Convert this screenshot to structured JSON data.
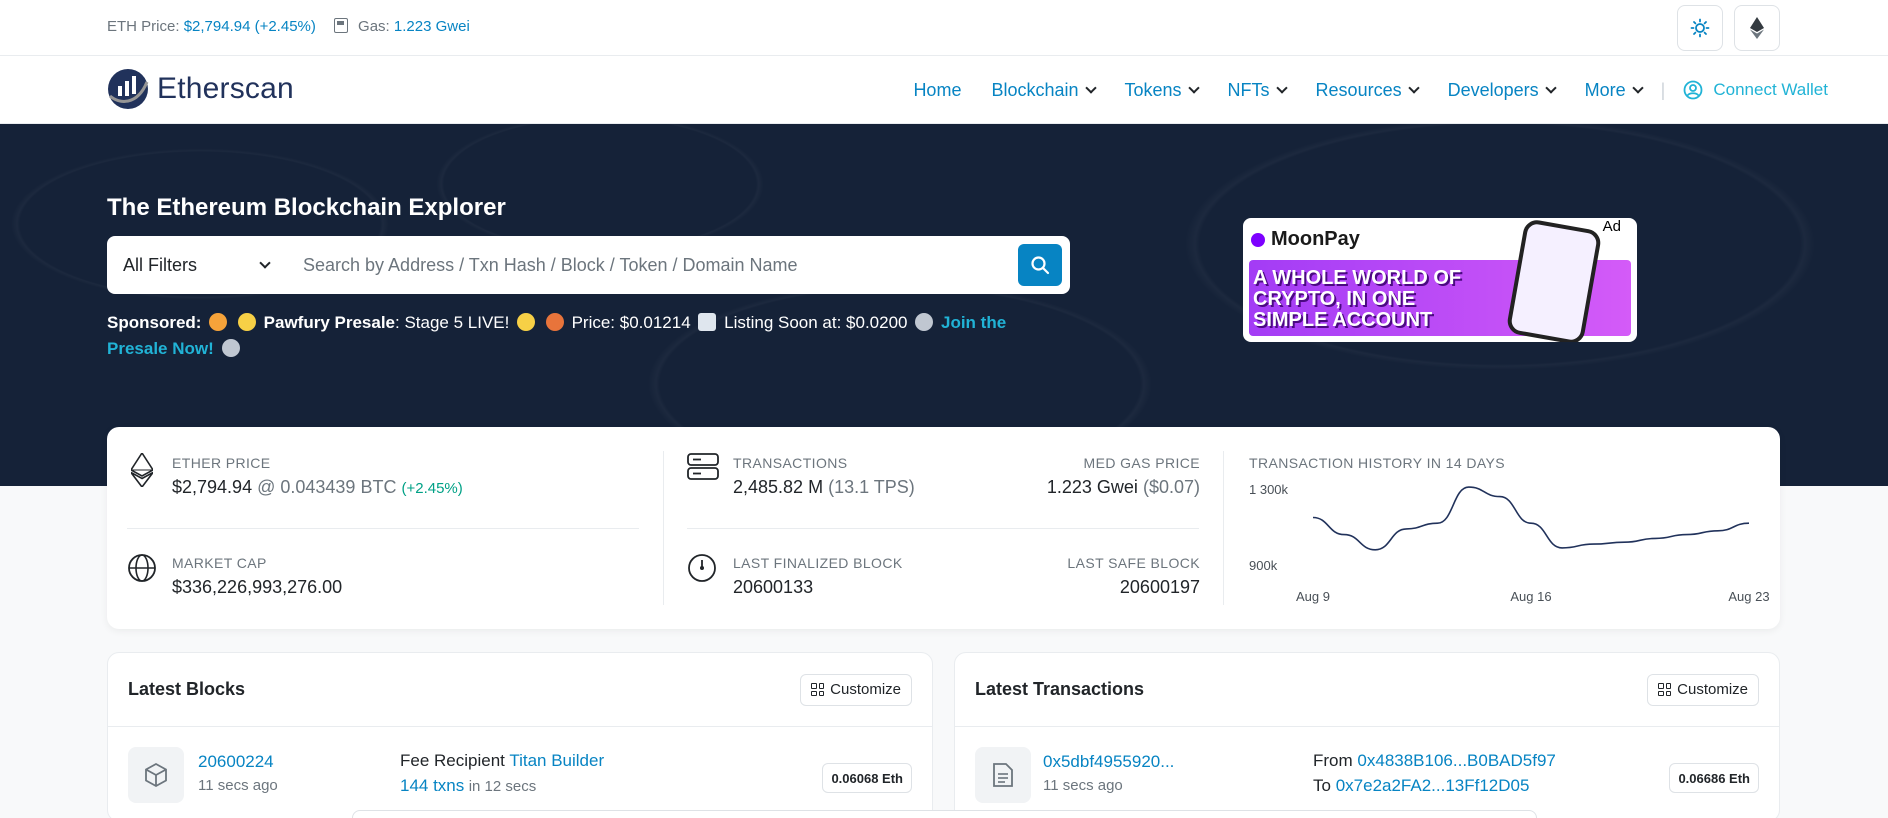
{
  "topbar": {
    "eth_price_label": "ETH Price:",
    "eth_price_value": "$2,794.94 (+2.45%)",
    "gas_label": "Gas:",
    "gas_value": "1.223 Gwei"
  },
  "nav": {
    "brand": "Etherscan",
    "items": [
      {
        "label": "Home"
      },
      {
        "label": "Blockchain"
      },
      {
        "label": "Tokens"
      },
      {
        "label": "NFTs"
      },
      {
        "label": "Resources"
      },
      {
        "label": "Developers"
      },
      {
        "label": "More"
      }
    ],
    "separator": "|",
    "connect_wallet": "Connect Wallet"
  },
  "hero": {
    "title": "The Ethereum Blockchain Explorer",
    "filter_label": "All Filters",
    "search_placeholder": "Search by Address / Txn Hash / Block / Token / Domain Name",
    "sponsored_label": "Sponsored:",
    "sponsored_name": "Pawfury Presale",
    "sponsored_text_1": ": Stage 5 LIVE!",
    "sponsored_text_2": "Price: $0.01214",
    "sponsored_text_3": "Listing Soon at: $0.0200",
    "sponsored_link": "Join the Presale Now!"
  },
  "ad": {
    "tag": "Ad",
    "brand": "MoonPay",
    "slogan": "A whole world of crypto, in one simple account"
  },
  "stats": {
    "ether_price_label": "ETHER PRICE",
    "ether_price_value": "$2,794.94",
    "ether_price_btc": "@ 0.043439 BTC",
    "ether_price_change": "(+2.45%)",
    "market_cap_label": "MARKET CAP",
    "market_cap_value": "$336,226,993,276.00",
    "transactions_label": "TRANSACTIONS",
    "transactions_value": "2,485.82 M",
    "transactions_tps": "(13.1 TPS)",
    "med_gas_label": "MED GAS PRICE",
    "med_gas_value": "1.223 Gwei",
    "med_gas_usd": "($0.07)",
    "last_finalized_label": "LAST FINALIZED BLOCK",
    "last_finalized_value": "20600133",
    "last_safe_label": "LAST SAFE BLOCK",
    "last_safe_value": "20600197"
  },
  "chart_data": {
    "type": "line",
    "title": "TRANSACTION HISTORY IN 14 DAYS",
    "x": [
      "Aug 9",
      "Aug 10",
      "Aug 11",
      "Aug 12",
      "Aug 13",
      "Aug 14",
      "Aug 15",
      "Aug 16",
      "Aug 17",
      "Aug 18",
      "Aug 19",
      "Aug 20",
      "Aug 21",
      "Aug 22",
      "Aug 23"
    ],
    "values": [
      1150000,
      1060000,
      980000,
      1090000,
      1120000,
      1310000,
      1260000,
      1120000,
      990000,
      1010000,
      1020000,
      1040000,
      1060000,
      1080000,
      1120000
    ],
    "x_tick_labels": [
      "Aug 9",
      "Aug 16",
      "Aug 23"
    ],
    "y_tick_labels": [
      "1 300k",
      "900k"
    ],
    "ylim": [
      900000,
      1300000
    ],
    "line_color": "#21325b"
  },
  "latest_blocks": {
    "title": "Latest Blocks",
    "customize": "Customize",
    "rows": [
      {
        "block": "20600224",
        "age": "11 secs ago",
        "fee_recipient_label": "Fee Recipient",
        "fee_recipient": "Titan Builder",
        "txns": "144 txns",
        "txns_time": "in 12 secs",
        "reward": "0.06068 Eth"
      }
    ]
  },
  "latest_transactions": {
    "title": "Latest Transactions",
    "customize": "Customize",
    "rows": [
      {
        "hash": "0x5dbf4955920...",
        "age": "11 secs ago",
        "from_label": "From",
        "from": "0x4838B106...B0BAD5f97",
        "to_label": "To",
        "to": "0x7e2a2FA2...13Ff12D05",
        "value": "0.06686 Eth"
      }
    ]
  }
}
